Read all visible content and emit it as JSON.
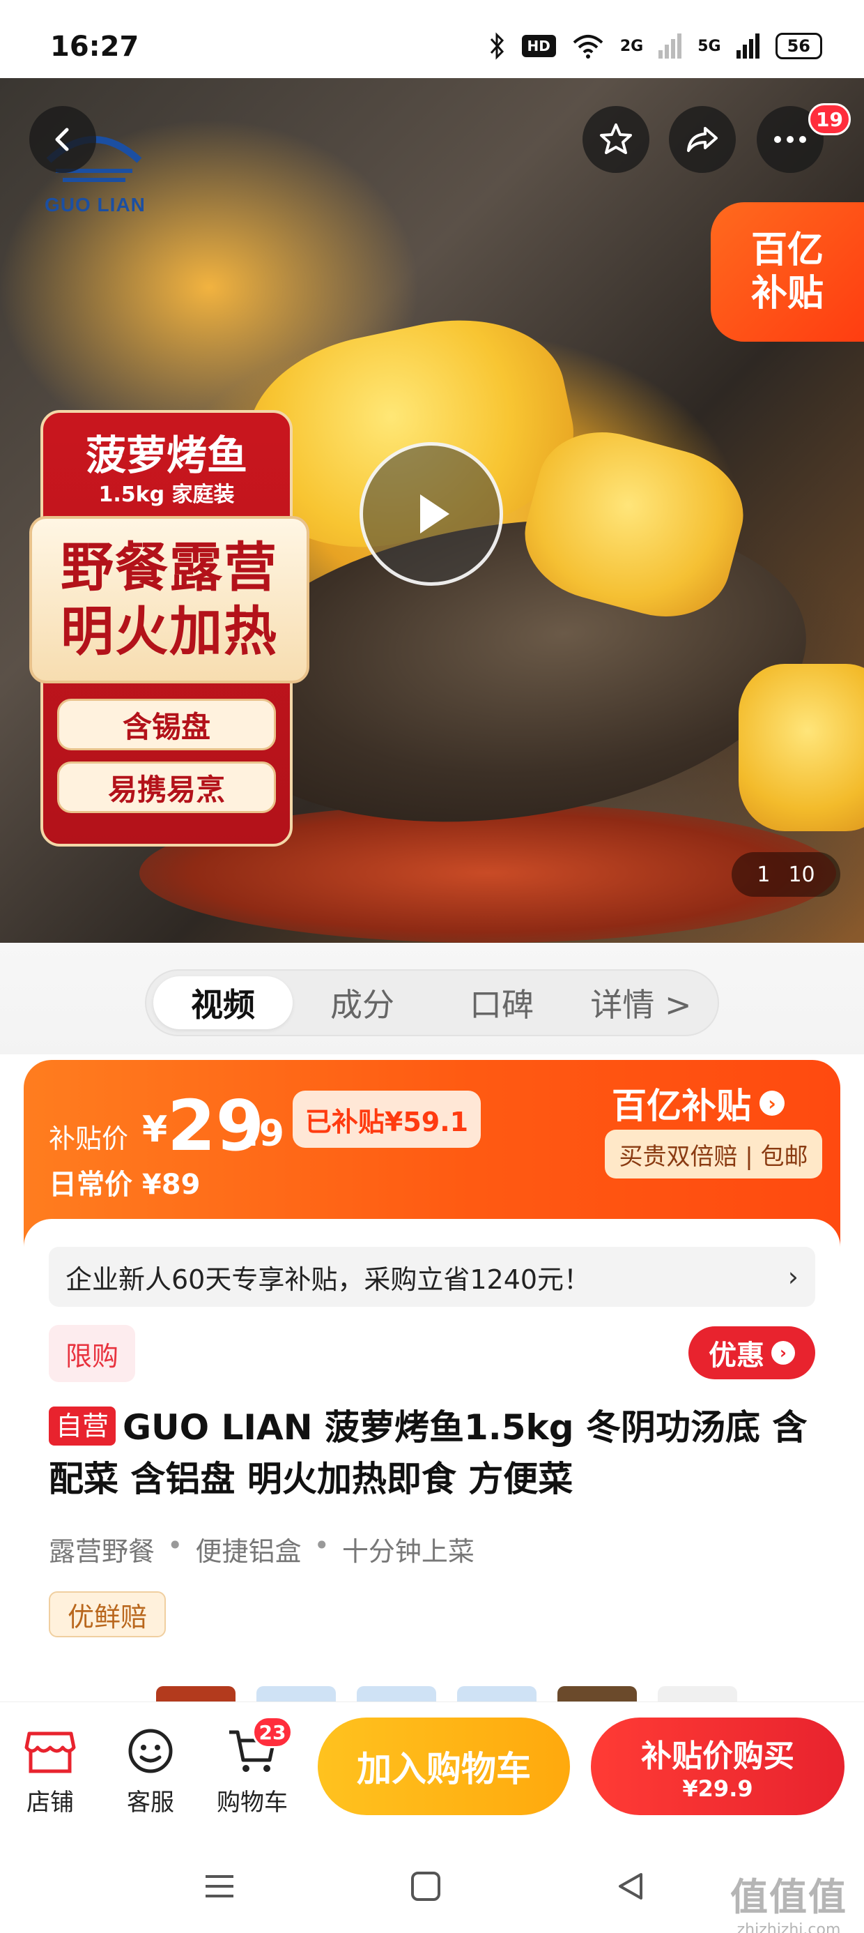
{
  "status_bar": {
    "time": "16:27",
    "hd": "HD",
    "signal_2g": "2G",
    "signal_5g": "5G",
    "battery": "56",
    "icons": [
      "bluetooth-icon",
      "wifi-icon",
      "signal-icon"
    ]
  },
  "hero": {
    "brand_logo": "GUO LIAN",
    "more_badge": "19",
    "yi_subsidy_line1": "百亿",
    "yi_subsidy_line2": "补贴",
    "promo": {
      "title": "菠萝烤鱼",
      "subtitle": "1.5kg 家庭装",
      "big_line1": "野餐露营",
      "big_line2": "明火加热",
      "pill1": "含锡盘",
      "pill2": "易携易烹"
    },
    "counter_current": "1",
    "counter_total": "10"
  },
  "tabs": [
    {
      "label": "视频",
      "active": true
    },
    {
      "label": "成分",
      "active": false
    },
    {
      "label": "口碑",
      "active": false
    },
    {
      "label": "详情 >",
      "active": false
    }
  ],
  "price": {
    "label": "补贴价",
    "yen": "¥",
    "integer": "29",
    "decimal": ".9",
    "subsidized": "已补贴¥59.1",
    "daily": "日常价 ¥89",
    "brand": "百亿补贴",
    "guarantee": "买贵双倍赔 | 包邮"
  },
  "product": {
    "notice": "企业新人60天专享补贴，采购立省1240元！",
    "limit_tag": "限购",
    "discount_button": "优惠",
    "self_tag": "自营",
    "title": "GUO LIAN 菠萝烤鱼1.5kg  冬阴功汤底 含配菜 含铝盘 明火加热即食 方便菜",
    "features": [
      "露营野餐",
      "便捷铝盒",
      "十分钟上菜"
    ],
    "fresh_tag": "优鲜赔"
  },
  "bottom_bar": {
    "shop": "店铺",
    "service": "客服",
    "cart": "购物车",
    "cart_badge": "23",
    "add_cart": "加入购物车",
    "buy_line1": "补贴价购买",
    "buy_line2": "¥29.9"
  },
  "watermark": {
    "main": "值值值",
    "sub": "zhizhizhi.com"
  },
  "colors": {
    "accent_orange": "#ff5a12",
    "accent_red": "#e8232e",
    "accent_yellow": "#ffb014"
  }
}
